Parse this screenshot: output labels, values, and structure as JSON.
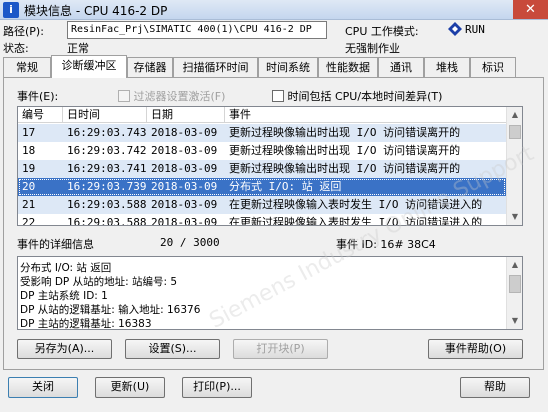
{
  "window": {
    "title": "模块信息 - CPU 416-2 DP",
    "close_label": "✕"
  },
  "info": {
    "path_label": "路径(P):",
    "path_value": "ResinFac_Prj\\SIMATIC 400(1)\\CPU 416-2 DP",
    "status_label": "状态:",
    "status_value": "正常",
    "cpu_mode_label": "CPU 工作模式:",
    "cpu_mode_value": "RUN",
    "force_text": "无强制作业"
  },
  "tabs": [
    "常规",
    "诊断缓冲区",
    "存储器",
    "扫描循环时间",
    "时间系统",
    "性能数据",
    "通讯",
    "堆栈",
    "标识"
  ],
  "events": {
    "label": "事件(E):",
    "filter_label": "过滤器设置激活(F)",
    "time_cpu_label": "时间包括 CPU/本地时间差异(T)",
    "columns": [
      "编号",
      "日时间",
      "日期",
      "事件"
    ],
    "rows": [
      [
        "17",
        "16:29:03.743",
        "2018-03-09",
        "更新过程映像输出时出现 I/O 访问错误离开的"
      ],
      [
        "18",
        "16:29:03.742",
        "2018-03-09",
        "更新过程映像输出时出现 I/O 访问错误离开的"
      ],
      [
        "19",
        "16:29:03.741",
        "2018-03-09",
        "更新过程映像输出时出现 I/O 访问错误离开的"
      ],
      [
        "20",
        "16:29:03.739",
        "2018-03-09",
        "分布式 I/O: 站 返回"
      ],
      [
        "21",
        "16:29:03.588",
        "2018-03-09",
        "在更新过程映像输入表时发生 I/O 访问错误进入的"
      ],
      [
        "22",
        "16:29:03.588",
        "2018-03-09",
        "在更新过程映像输入表时发生 I/O 访问错误进入的"
      ]
    ],
    "selected_index": 3
  },
  "details": {
    "label": "事件的详细信息",
    "position": "20 / 3000",
    "event_id": "事件 ID: 16# 38C4",
    "lines": [
      "分布式 I/O: 站 返回",
      "受影响 DP 从站的地址: 站编号:    5",
      "DP 主站系统 ID:     1",
      "DP 从站的逻辑基址: 输入地址:   16376",
      "DP 主站的逻辑基址:   16383"
    ]
  },
  "panel_buttons": {
    "save_as": "另存为(A)...",
    "settings": "设置(S)...",
    "open_block": "打开块(P)",
    "event_help": "事件帮助(O)"
  },
  "footer_buttons": {
    "close": "关闭",
    "update": "更新(U)",
    "print": "打印(P)...",
    "help": "帮助"
  },
  "watermark": "Siemens Industry Online Support"
}
